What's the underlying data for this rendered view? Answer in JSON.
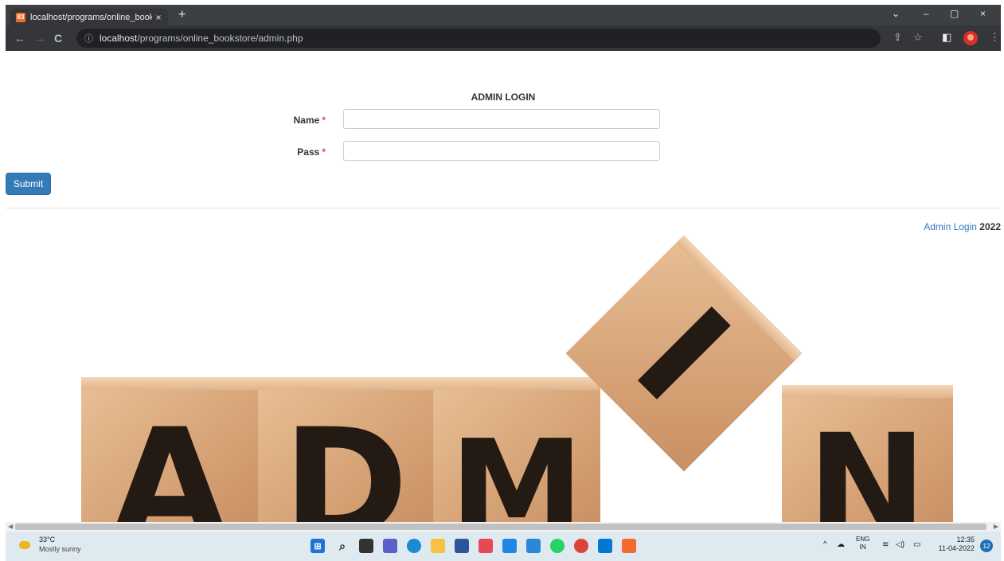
{
  "browser": {
    "tab_title": "localhost/programs/online_book",
    "favicon_text": "83",
    "close_glyph": "×",
    "new_tab_glyph": "+",
    "url_host": "localhost",
    "url_path": "/programs/online_bookstore/admin.php",
    "window_controls": {
      "dropdown": "⌄",
      "minimize": "–",
      "maximize": "▢",
      "close": "×"
    }
  },
  "page": {
    "heading": "ADMIN LOGIN",
    "fields": [
      {
        "label": "Name",
        "required_mark": "*",
        "value": ""
      },
      {
        "label": "Pass",
        "required_mark": "*",
        "value": ""
      }
    ],
    "submit_label": "Submit",
    "footer": {
      "link_text": "Admin Login",
      "year": "2022"
    },
    "image_letters": [
      "A",
      "D",
      "M",
      "I",
      "N"
    ]
  },
  "taskbar": {
    "weather_temp": "33°C",
    "weather_desc": "Mostly sunny",
    "lang_line1": "ENG",
    "lang_line2": "IN",
    "time": "12:35",
    "date": "11-04-2022",
    "notification_count": "12"
  }
}
